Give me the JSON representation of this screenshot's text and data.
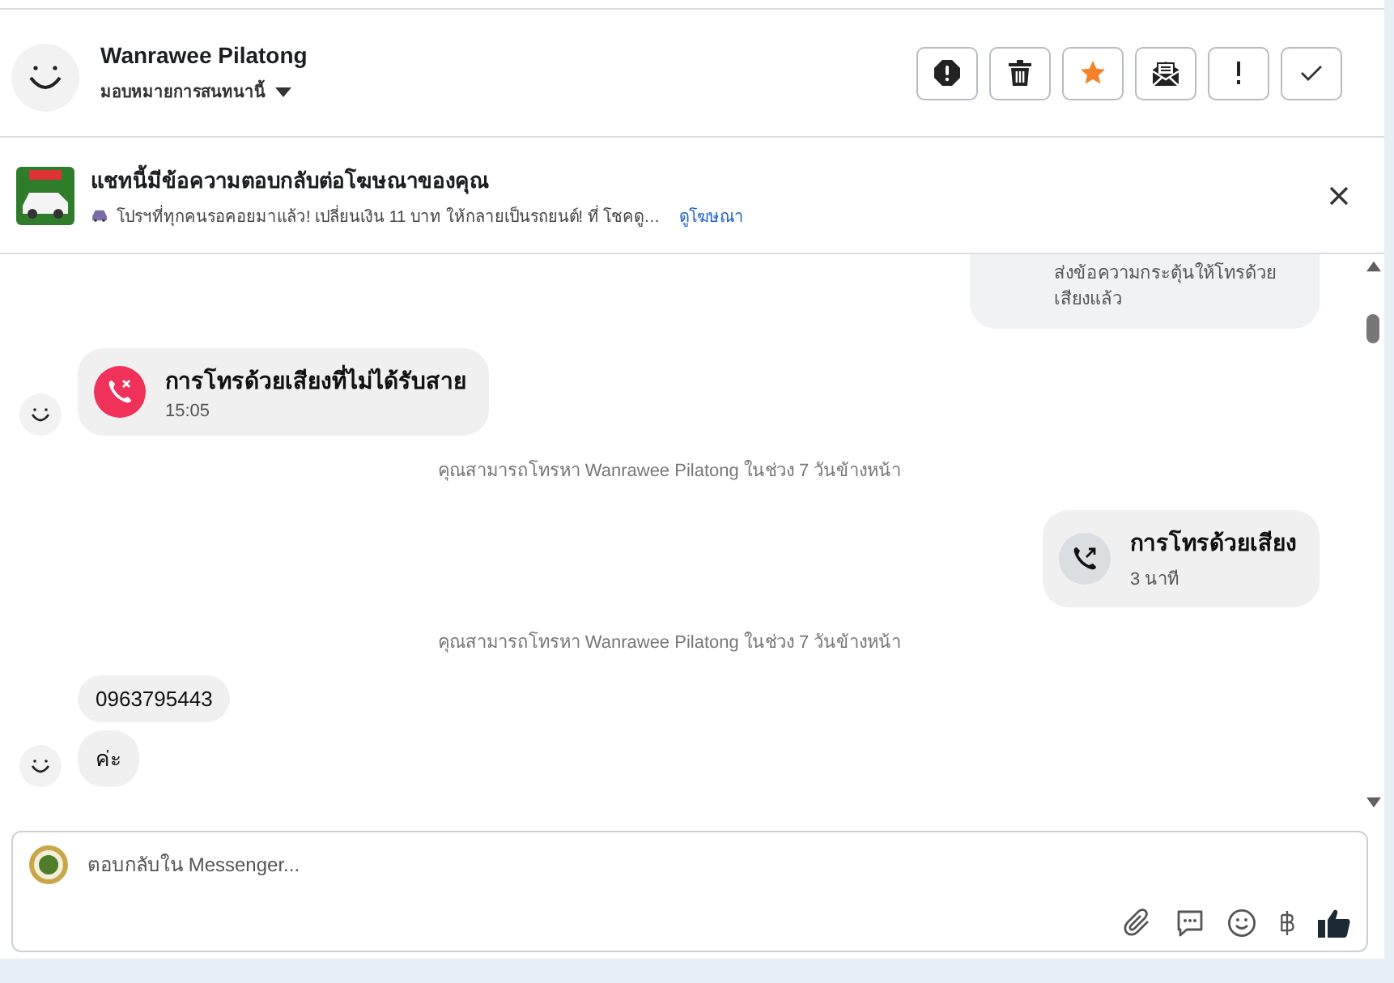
{
  "header": {
    "name": "Wanrawee Pilatong",
    "assign_label": "มอบหมายการสนทนานี้"
  },
  "actions": [
    {
      "kind": "alert"
    },
    {
      "kind": "trash"
    },
    {
      "kind": "star"
    },
    {
      "kind": "mail"
    },
    {
      "kind": "important"
    },
    {
      "kind": "done"
    }
  ],
  "ad_banner": {
    "title": "แชทนี้มีข้อความตอบกลับต่อโฆษณาของคุณ",
    "description": "โปรฯที่ทุกคนรอคอยมาแล้ว! เปลี่ยนเงิน 11 บาท ให้กลายเป็นรถยนต์! ที่ โชคดู…",
    "link": "ดูโฆษณา"
  },
  "messages": [
    {
      "kind": "note",
      "outgoing": true,
      "text": "ส่งข้อความกระตุ้นให้โทรด้วยเสียงแล้ว"
    },
    {
      "kind": "call",
      "outgoing": false,
      "missed": true,
      "title": "การโทรด้วยเสียงที่ไม่ได้รับสาย",
      "detail": "15:05"
    },
    {
      "kind": "system",
      "text": "คุณสามารถโทรหา Wanrawee Pilatong ในช่วง 7 วันข้างหน้า"
    },
    {
      "kind": "call",
      "outgoing": true,
      "missed": false,
      "title": "การโทรด้วยเสียง",
      "detail": "3 นาที"
    },
    {
      "kind": "system",
      "text": "คุณสามารถโทรหา Wanrawee Pilatong ในช่วง 7 วันข้างหน้า"
    },
    {
      "kind": "group",
      "outgoing": false,
      "texts": [
        "0963795443",
        "ค่ะ"
      ]
    }
  ],
  "composer": {
    "placeholder": "ตอบกลับใน Messenger..."
  },
  "tools": [
    {
      "kind": "attach"
    },
    {
      "kind": "saved-reply"
    },
    {
      "kind": "emoji"
    },
    {
      "kind": "baht"
    },
    {
      "kind": "like"
    }
  ]
}
